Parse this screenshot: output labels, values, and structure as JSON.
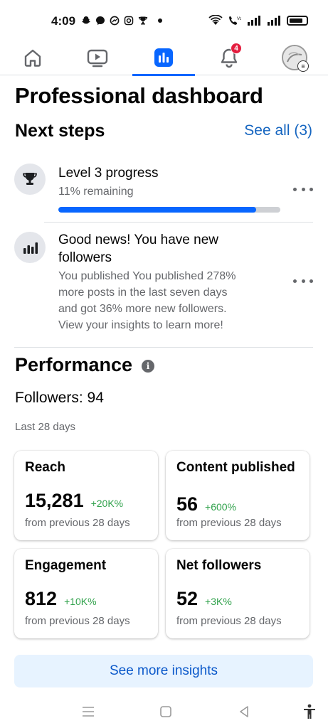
{
  "status_bar": {
    "time": "4:09",
    "notification_icons": [
      "snapchat-icon",
      "messenger-icon",
      "messenger-outline-icon",
      "instagram-icon",
      "trophy-icon"
    ],
    "system_icons": [
      "wifi-icon",
      "call-icon",
      "signal-icon",
      "signal-icon-2",
      "battery-icon"
    ]
  },
  "top_nav": {
    "items": [
      {
        "name": "home",
        "icon": "home-icon"
      },
      {
        "name": "video",
        "icon": "video-icon"
      },
      {
        "name": "dashboard",
        "icon": "dashboard-icon",
        "active": true
      },
      {
        "name": "notifications",
        "icon": "bell-icon",
        "badge": "4"
      },
      {
        "name": "profile",
        "icon": "avatar"
      }
    ],
    "accent": "#0866ff"
  },
  "page": {
    "title": "Professional dashboard"
  },
  "next_steps": {
    "title": "Next steps",
    "see_all": "See all (3)",
    "items": [
      {
        "icon": "trophy-icon",
        "title": "Level 3 progress",
        "subtitle": "11% remaining",
        "progress_fraction": 0.89
      },
      {
        "icon": "bar-chart-icon",
        "title_line1": "Good news! You have new",
        "title_line2": "followers",
        "body_line1": "You published You published 278%",
        "body_line2": "more posts in the last seven days",
        "body_line3": "and got 36% more new followers.",
        "body_line4": "View your insights to learn more!"
      }
    ]
  },
  "performance": {
    "title": "Performance",
    "followers": "Followers: 94",
    "period": "Last 28 days",
    "metrics": [
      {
        "label": "Reach",
        "value": "15,281",
        "change": "+20K%",
        "compare": "from previous 28 days"
      },
      {
        "label": "Content published",
        "value": "56",
        "change": "+600%",
        "compare": "from previous 28 days"
      },
      {
        "label": "Engagement",
        "value": "812",
        "change": "+10K%",
        "compare": "from previous 28 days"
      },
      {
        "label": "Net followers",
        "value": "52",
        "change": "+3K%",
        "compare": "from previous 28 days"
      }
    ],
    "insights_button": "See more insights"
  },
  "colors": {
    "primary": "#0866ff",
    "link": "#1565c0",
    "positive": "#31a24c",
    "badge": "#e41e3f",
    "insights_bg": "#e7f3ff"
  }
}
